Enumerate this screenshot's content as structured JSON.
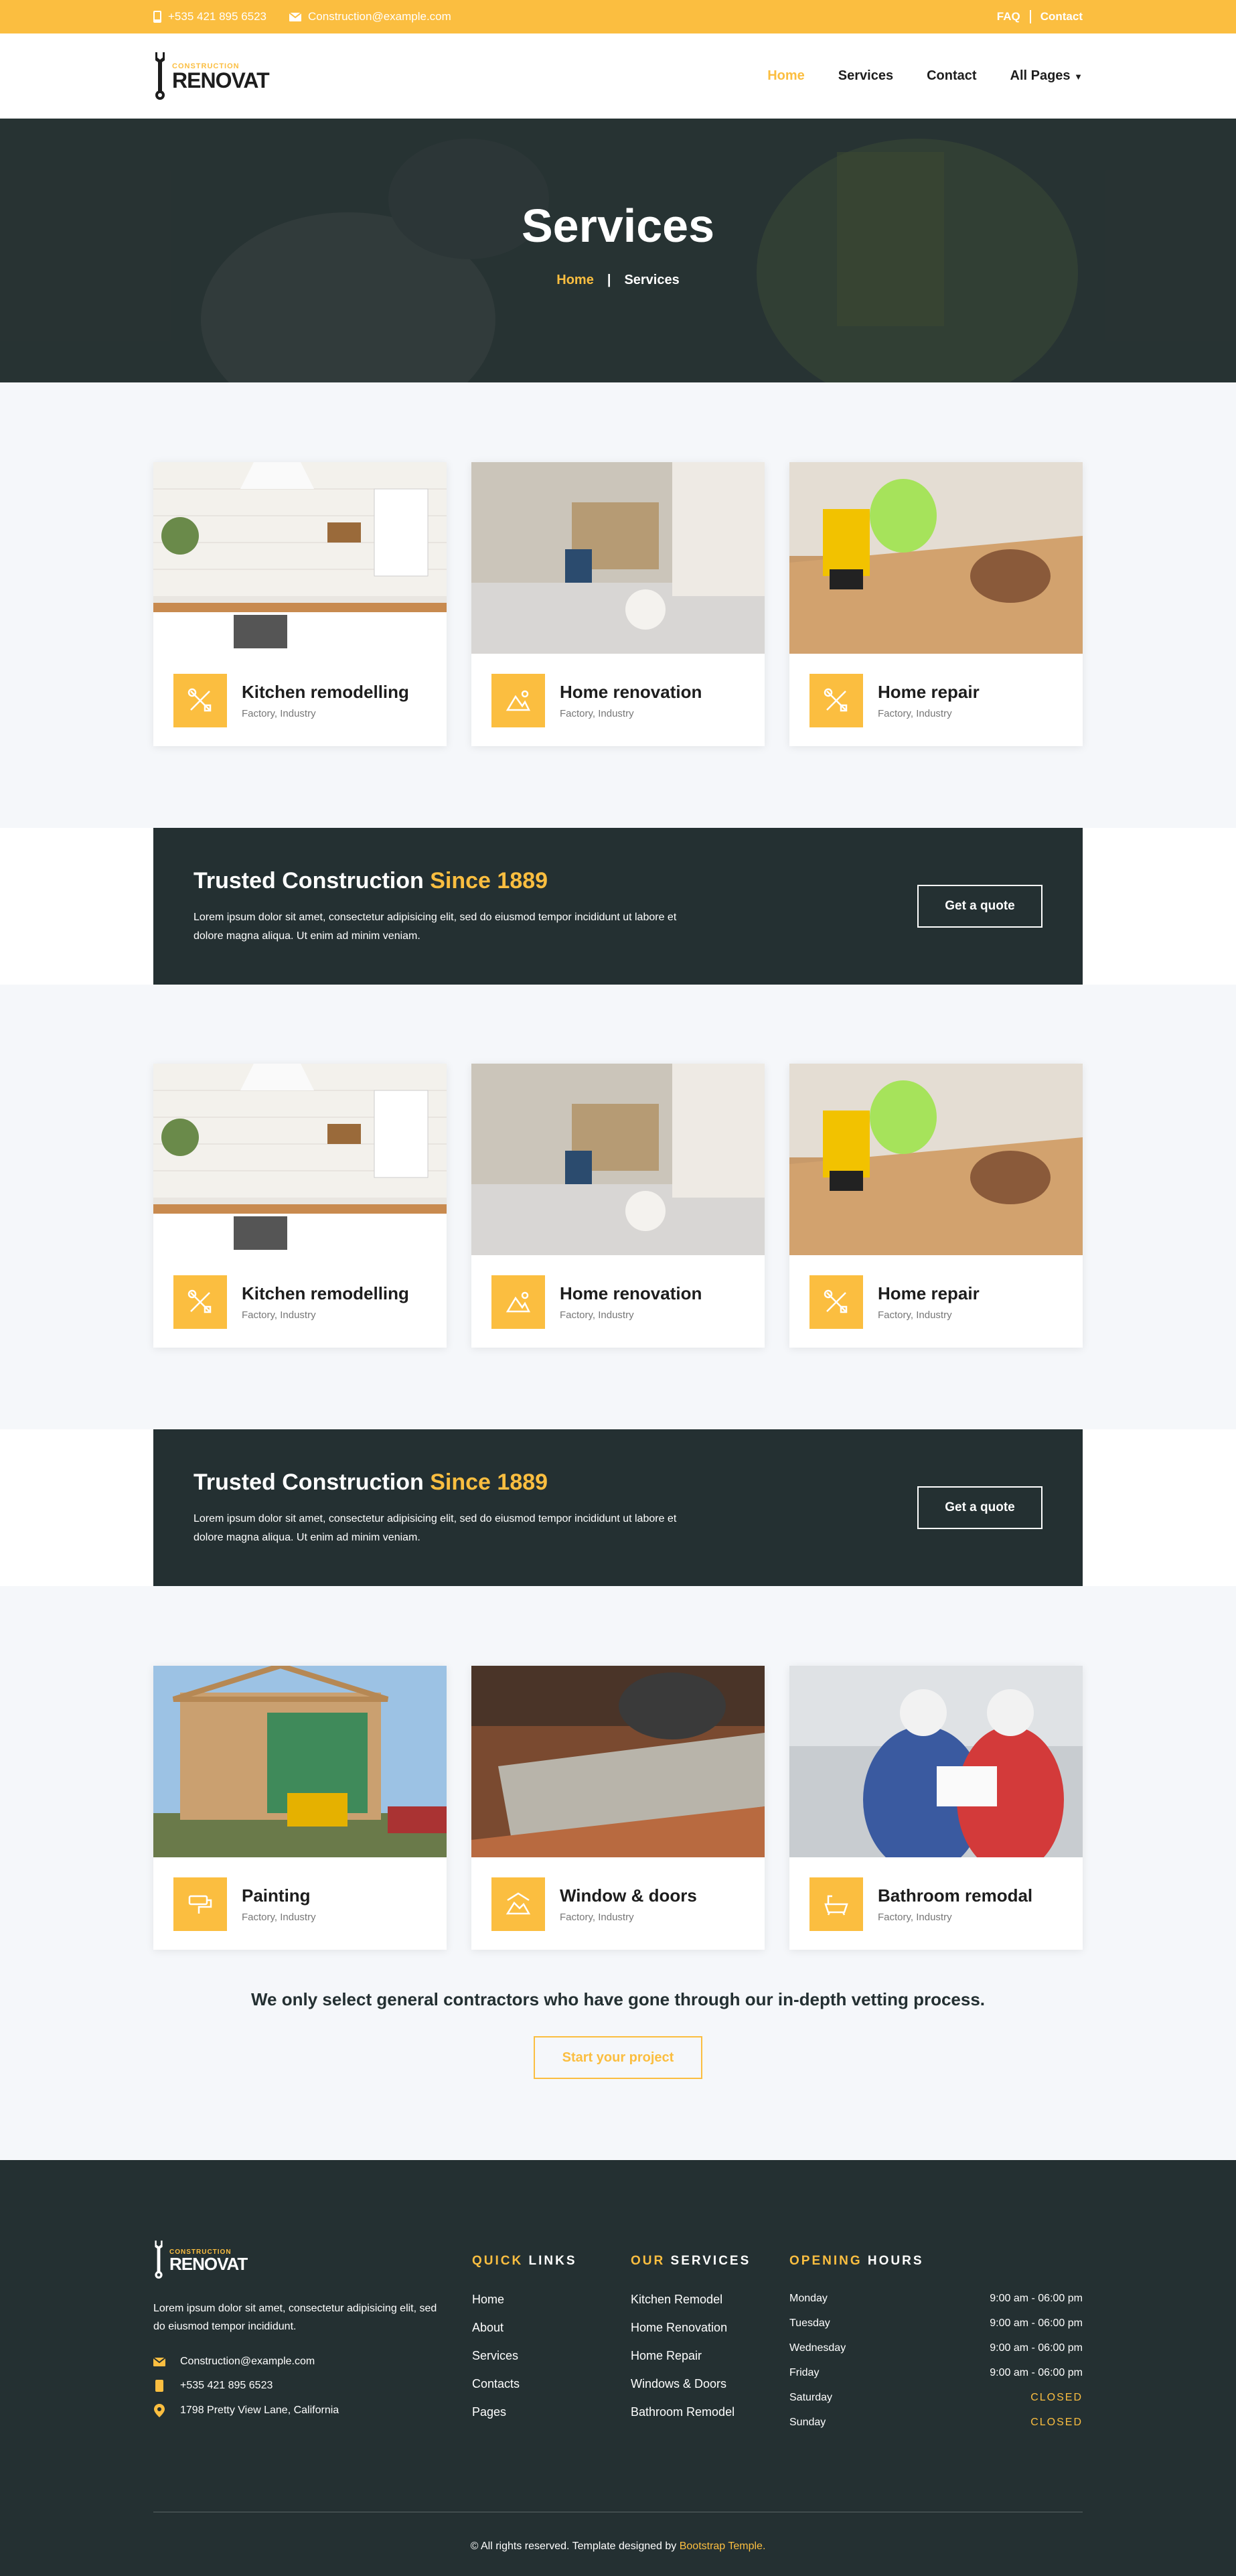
{
  "topbar": {
    "phone": "+535 421 895 6523",
    "email": "Construction@example.com",
    "faq": "FAQ",
    "contact": "Contact"
  },
  "brand": {
    "small": "CONSTRUCTION",
    "name": "RENOVAT"
  },
  "nav": {
    "items": [
      "Home",
      "Services",
      "Contact",
      "All Pages"
    ]
  },
  "hero": {
    "title": "Services",
    "breadcrumb_home": "Home",
    "breadcrumb_sep": "|",
    "breadcrumb_current": "Services"
  },
  "cards_row1": [
    {
      "title": "Kitchen remodelling",
      "tags": "Factory,  Industry"
    },
    {
      "title": "Home renovation",
      "tags": "Factory,  Industry"
    },
    {
      "title": "Home repair",
      "tags": "Factory,  Industry"
    }
  ],
  "cards_row2": [
    {
      "title": "Kitchen remodelling",
      "tags": "Factory,  Industry"
    },
    {
      "title": "Home renovation",
      "tags": "Factory,  Industry"
    },
    {
      "title": "Home repair",
      "tags": "Factory,  Industry"
    }
  ],
  "cards_row3": [
    {
      "title": "Painting",
      "tags": "Factory,  Industry"
    },
    {
      "title": "Window & doors",
      "tags": "Factory,  Industry"
    },
    {
      "title": "Bathroom remodal",
      "tags": "Factory,  Industry"
    }
  ],
  "cta": {
    "title": "Trusted Construction",
    "title_highlight": "Since 1889",
    "text": "Lorem ipsum dolor sit amet, consectetur adipisicing elit, sed do eiusmod tempor incididunt ut labore et dolore magna aliqua. Ut enim ad minim veniam.",
    "button": "Get a quote"
  },
  "vetting": {
    "text": "We only select general contractors who have gone through our in-depth vetting process.",
    "button": "Start your project"
  },
  "footer": {
    "about": "Lorem ipsum dolor sit amet, consectetur adipisicing elit, sed do eiusmod tempor incididunt.",
    "email": "Construction@example.com",
    "phone": "+535 421 895 6523",
    "address": "1798 Pretty View Lane, California",
    "quick_links_title_a": "QUICK",
    "quick_links_title_b": "LINKS",
    "quick_links": [
      "Home",
      "About",
      "Services",
      "Contacts",
      "Pages"
    ],
    "services_title_a": "OUR",
    "services_title_b": "SERVICES",
    "services": [
      "Kitchen Remodel",
      "Home Renovation",
      "Home Repair",
      "Windows & Doors",
      "Bathroom Remodel"
    ],
    "hours_title_a": "OPENING",
    "hours_title_b": "HOURS",
    "hours": [
      {
        "day": "Monday",
        "time": "9:00 am - 06:00 pm"
      },
      {
        "day": "Tuesday",
        "time": "9:00 am - 06:00 pm"
      },
      {
        "day": "Wednesday",
        "time": "9:00 am - 06:00 pm"
      },
      {
        "day": "Friday",
        "time": "9:00 am - 06:00 pm"
      },
      {
        "day": "Saturday",
        "time": "CLOSED"
      },
      {
        "day": "Sunday",
        "time": "CLOSED"
      }
    ],
    "copyright": "© All rights reserved. Template designed by",
    "copyright_link": "Bootstrap Temple."
  },
  "colors": {
    "accent": "#fbbe40",
    "dark": "#243032"
  }
}
